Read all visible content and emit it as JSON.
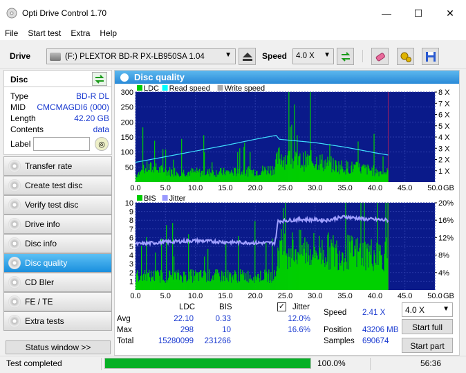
{
  "window": {
    "title": "Opti Drive Control 1.70",
    "minimize": "—",
    "maximize": "☐",
    "close": "✕"
  },
  "menu": [
    "File",
    "Start test",
    "Extra",
    "Help"
  ],
  "toolbar": {
    "drive_label": "Drive",
    "drive_value": "(F:)   PLEXTOR BD-R  PX-LB950SA 1.04",
    "speed_label": "Speed",
    "speed_value": "4.0 X"
  },
  "disc": {
    "header": "Disc",
    "fields": [
      {
        "key": "Type",
        "value": "BD-R DL"
      },
      {
        "key": "MID",
        "value": "CMCMAGDI6 (000)"
      },
      {
        "key": "Length",
        "value": "42.20 GB"
      },
      {
        "key": "Contents",
        "value": "data"
      }
    ],
    "label_key": "Label",
    "label_value": ""
  },
  "nav": [
    {
      "label": "Transfer rate",
      "active": false
    },
    {
      "label": "Create test disc",
      "active": false
    },
    {
      "label": "Verify test disc",
      "active": false
    },
    {
      "label": "Drive info",
      "active": false
    },
    {
      "label": "Disc info",
      "active": false
    },
    {
      "label": "Disc quality",
      "active": true
    },
    {
      "label": "CD Bler",
      "active": false
    },
    {
      "label": "FE / TE",
      "active": false
    },
    {
      "label": "Extra tests",
      "active": false
    }
  ],
  "status_window_button": "Status window >>",
  "panel_title": "Disc quality",
  "chart_data": [
    {
      "type": "bar",
      "title": "LDC / Read speed",
      "legend": [
        "LDC",
        "Read speed",
        "Write speed"
      ],
      "legend_colors": [
        "#00cc00",
        "#00ffff",
        "#aaaaaa"
      ],
      "xlabel": "GB",
      "x_ticks": [
        "0.0",
        "5.0",
        "10.0",
        "15.0",
        "20.0",
        "25.0",
        "30.0",
        "35.0",
        "40.0",
        "45.0",
        "50.0"
      ],
      "xlim": [
        0,
        50
      ],
      "y_ticks_left": [
        "50",
        "100",
        "150",
        "200",
        "250",
        "300"
      ],
      "ylim_left": [
        0,
        300
      ],
      "y_ticks_right": [
        "1 X",
        "2 X",
        "3 X",
        "4 X",
        "5 X",
        "6 X",
        "7 X",
        "8 X"
      ],
      "ylim_right": [
        0,
        8
      ],
      "data_end_gb": 42.2,
      "read_speed": {
        "x": [
          0,
          5,
          10,
          15,
          20,
          23.5,
          24,
          30,
          35,
          40,
          42.2
        ],
        "y": [
          1.75,
          2.25,
          2.75,
          3.25,
          3.8,
          4.15,
          3.8,
          3.5,
          3.1,
          2.6,
          2.4
        ]
      },
      "ldc_envelope": {
        "x": [
          0,
          2,
          5,
          10,
          15,
          20,
          23,
          24,
          25,
          27,
          30,
          32,
          34,
          36,
          38,
          40,
          42.2
        ],
        "y": [
          30,
          60,
          45,
          40,
          40,
          45,
          55,
          110,
          100,
          85,
          90,
          75,
          65,
          60,
          55,
          45,
          40
        ]
      },
      "ldc_max": 298
    },
    {
      "type": "bar",
      "title": "BIS / Jitter",
      "legend": [
        "BIS",
        "Jitter"
      ],
      "legend_colors": [
        "#00cc00",
        "#9999ff"
      ],
      "xlabel": "GB",
      "x_ticks": [
        "0.0",
        "5.0",
        "10.0",
        "15.0",
        "20.0",
        "25.0",
        "30.0",
        "35.0",
        "40.0",
        "45.0",
        "50.0"
      ],
      "xlim": [
        0,
        50
      ],
      "y_ticks_left": [
        "1",
        "2",
        "3",
        "4",
        "5",
        "6",
        "7",
        "8",
        "9",
        "10"
      ],
      "ylim_left": [
        0,
        10
      ],
      "y_ticks_right": [
        "4%",
        "8%",
        "12%",
        "16%",
        "20%"
      ],
      "ylim_right": [
        0,
        20
      ],
      "data_end_gb": 42.2,
      "jitter": {
        "x": [
          0,
          5,
          10,
          15,
          20,
          23.3,
          23.8,
          28,
          32,
          35,
          38,
          42.2
        ],
        "y": [
          10.5,
          11.0,
          11.3,
          11.0,
          10.8,
          10.8,
          15.8,
          16.2,
          16.0,
          16.8,
          16.3,
          16.0
        ]
      },
      "bis_envelope": {
        "x": [
          0,
          23.3,
          23.8,
          42.2
        ],
        "y": [
          2,
          2,
          6,
          5
        ]
      },
      "bis_max": 10
    }
  ],
  "stats": {
    "col_ldc": "LDC",
    "col_bis": "BIS",
    "jitter_label": "Jitter",
    "jitter_checked": true,
    "rows": [
      {
        "label": "Avg",
        "ldc": "22.10",
        "bis": "0.33",
        "jitter": "12.0%"
      },
      {
        "label": "Max",
        "ldc": "298",
        "bis": "10",
        "jitter": "16.6%"
      },
      {
        "label": "Total",
        "ldc": "15280099",
        "bis": "231266",
        "jitter": ""
      }
    ],
    "speed_label": "Speed",
    "speed_value": "2.41 X",
    "position_label": "Position",
    "position_value": "43206 MB",
    "samples_label": "Samples",
    "samples_value": "690674",
    "speed_select": "4.0 X",
    "start_full": "Start full",
    "start_part": "Start part"
  },
  "statusbar": {
    "text": "Test completed",
    "progress": 100.0,
    "progress_text": "100.0%",
    "time": "56:36"
  }
}
